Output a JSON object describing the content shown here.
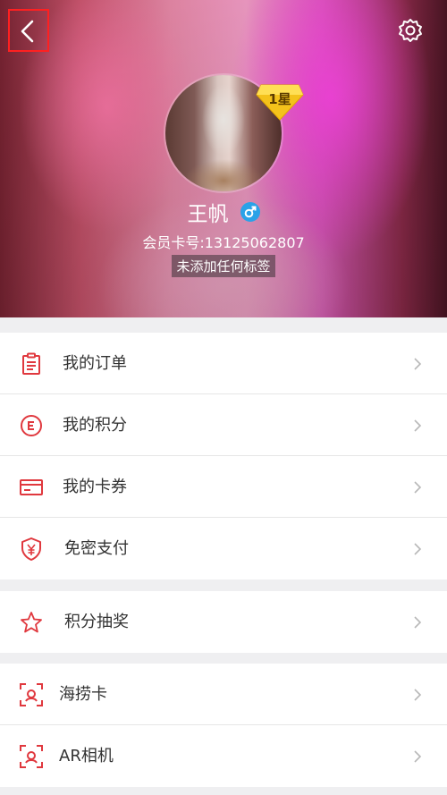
{
  "header": {
    "back_icon": "chevron-left-icon",
    "settings_icon": "gear-icon"
  },
  "profile": {
    "star_badge": "1星",
    "name": "王帆",
    "gender_icon": "male-icon",
    "member_card": "会员卡号:13125062807",
    "tag": "未添加任何标签"
  },
  "menu_groups": [
    {
      "items": [
        {
          "label": "我的订单",
          "icon": "order-list-icon"
        },
        {
          "label": "我的积分",
          "icon": "points-icon"
        },
        {
          "label": "我的卡券",
          "icon": "card-coupon-icon"
        },
        {
          "label": "免密支付",
          "icon": "shield-yen-icon"
        }
      ]
    },
    {
      "items": [
        {
          "label": "积分抽奖",
          "icon": "star-icon"
        }
      ]
    },
    {
      "items": [
        {
          "label": "海捞卡",
          "icon": "scan-card-icon"
        },
        {
          "label": "AR相机",
          "icon": "ar-camera-icon"
        }
      ]
    }
  ],
  "colors": {
    "accent": "#e0383e",
    "chevron": "#b8b8b8"
  }
}
